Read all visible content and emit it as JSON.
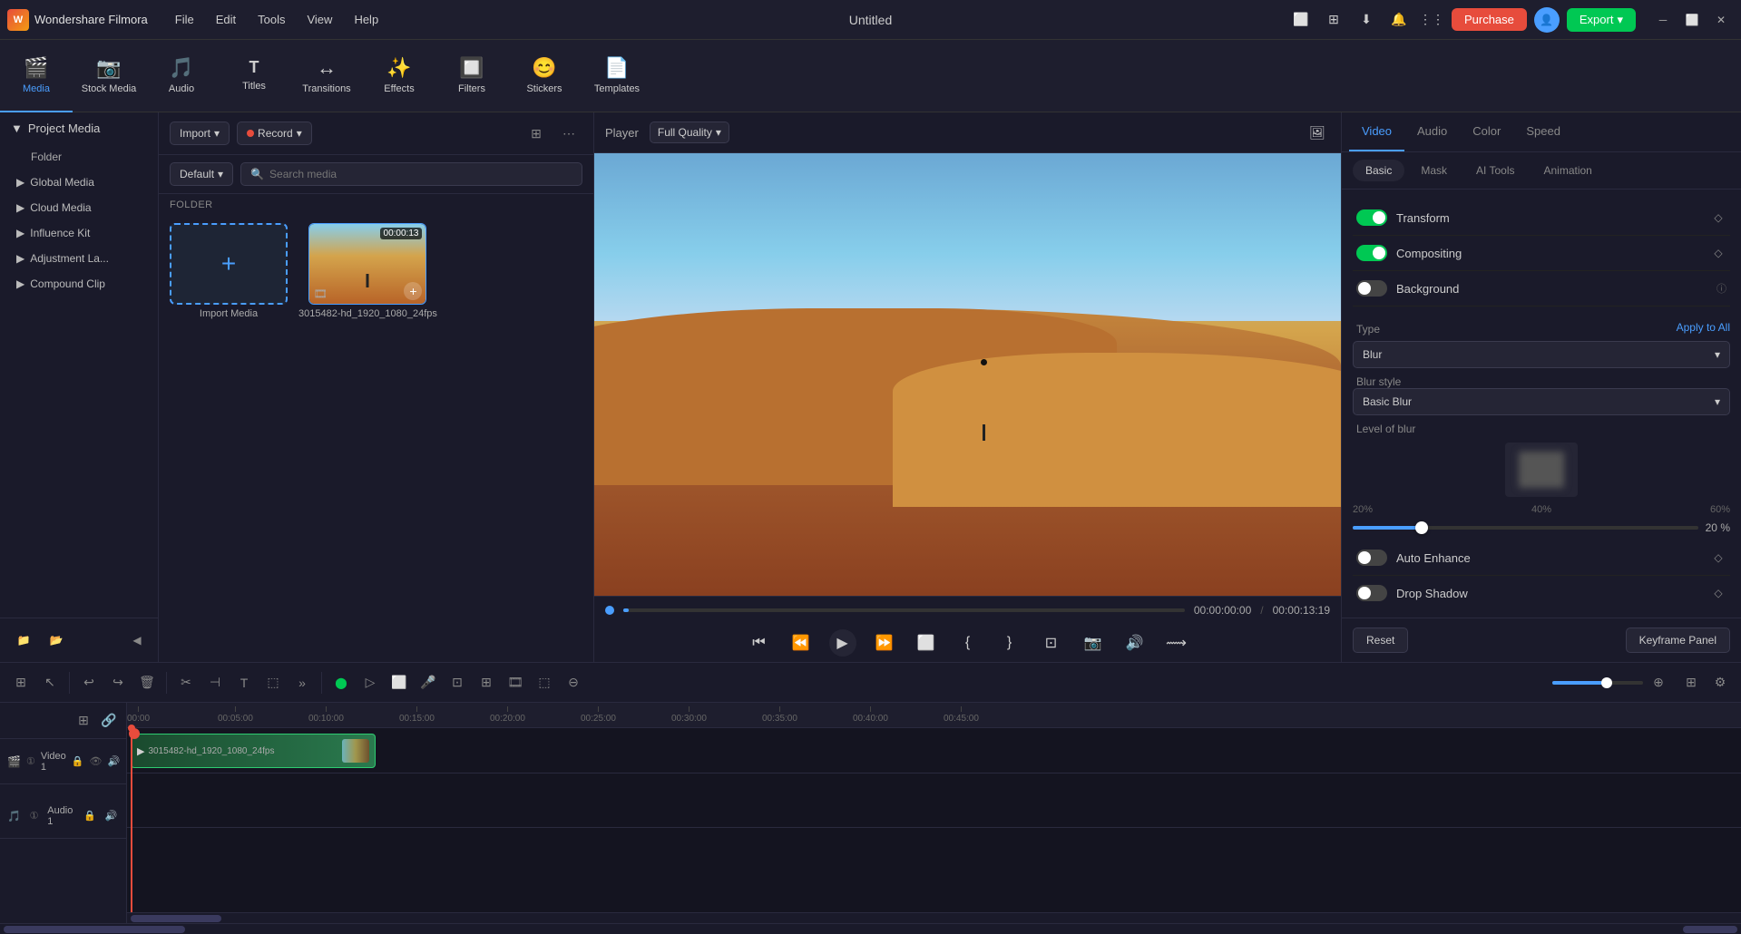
{
  "app": {
    "name": "Wondershare Filmora",
    "title": "Untitled"
  },
  "menu": {
    "items": [
      "File",
      "Edit",
      "Tools",
      "View",
      "Help"
    ]
  },
  "top_right": {
    "purchase_label": "Purchase",
    "export_label": "Export"
  },
  "toolbar": {
    "items": [
      {
        "icon": "🎬",
        "label": "Media",
        "active": true
      },
      {
        "icon": "📷",
        "label": "Stock Media",
        "active": false
      },
      {
        "icon": "🎵",
        "label": "Audio",
        "active": false
      },
      {
        "icon": "T",
        "label": "Titles",
        "active": false
      },
      {
        "icon": "✨",
        "label": "Transitions",
        "active": false
      },
      {
        "icon": "🌟",
        "label": "Effects",
        "active": false
      },
      {
        "icon": "🔲",
        "label": "Filters",
        "active": false
      },
      {
        "icon": "😊",
        "label": "Stickers",
        "active": false
      },
      {
        "icon": "📄",
        "label": "Templates",
        "active": false
      }
    ]
  },
  "sidebar": {
    "header": "Project Media",
    "items": [
      {
        "label": "Folder"
      },
      {
        "label": "Global Media"
      },
      {
        "label": "Cloud Media"
      },
      {
        "label": "Influence Kit"
      },
      {
        "label": "Adjustment La..."
      },
      {
        "label": "Compound Clip"
      }
    ]
  },
  "media_panel": {
    "import_label": "Import",
    "record_label": "Record",
    "default_label": "Default",
    "search_placeholder": "Search media",
    "folder_label": "FOLDER",
    "import_media_label": "Import Media",
    "video_label": "3015482-hd_1920_1080_24fps",
    "video_duration": "00:00:13"
  },
  "player": {
    "label": "Player",
    "quality": "Full Quality",
    "time_current": "00:00:00:00",
    "time_total": "00:00:13:19",
    "progress_pct": 1
  },
  "right_panel": {
    "tabs": [
      "Video",
      "Audio",
      "Color",
      "Speed"
    ],
    "active_tab": "Video",
    "sub_tabs": [
      "Basic",
      "Mask",
      "AI Tools",
      "Animation"
    ],
    "active_sub": "Basic",
    "properties": {
      "transform_label": "Transform",
      "compositing_label": "Compositing",
      "background_label": "Background",
      "type_label": "Type",
      "apply_to_all_label": "Apply to All",
      "blur_label": "Blur",
      "blur_style_label": "Blur style",
      "basic_blur_label": "Basic Blur",
      "level_label": "Level of blur",
      "level_20": "20%",
      "level_40": "40%",
      "level_60": "60%",
      "slider_value": "20",
      "slider_pct": "%",
      "auto_enhance_label": "Auto Enhance",
      "drop_shadow_label": "Drop Shadow",
      "reset_label": "Reset",
      "keyframe_label": "Keyframe Panel"
    }
  },
  "timeline": {
    "tracks": [
      {
        "name": "Video 1",
        "type": "video"
      },
      {
        "name": "Audio 1",
        "type": "audio"
      }
    ],
    "clip_label": "3015482-hd_1920_1080_24fps",
    "ruler_marks": [
      "00:00",
      "00:05:00",
      "00:10:00",
      "00:15:00",
      "00:20:00",
      "00:25:00",
      "00:30:00",
      "00:35:00",
      "00:40:00",
      "00:45:00"
    ]
  }
}
